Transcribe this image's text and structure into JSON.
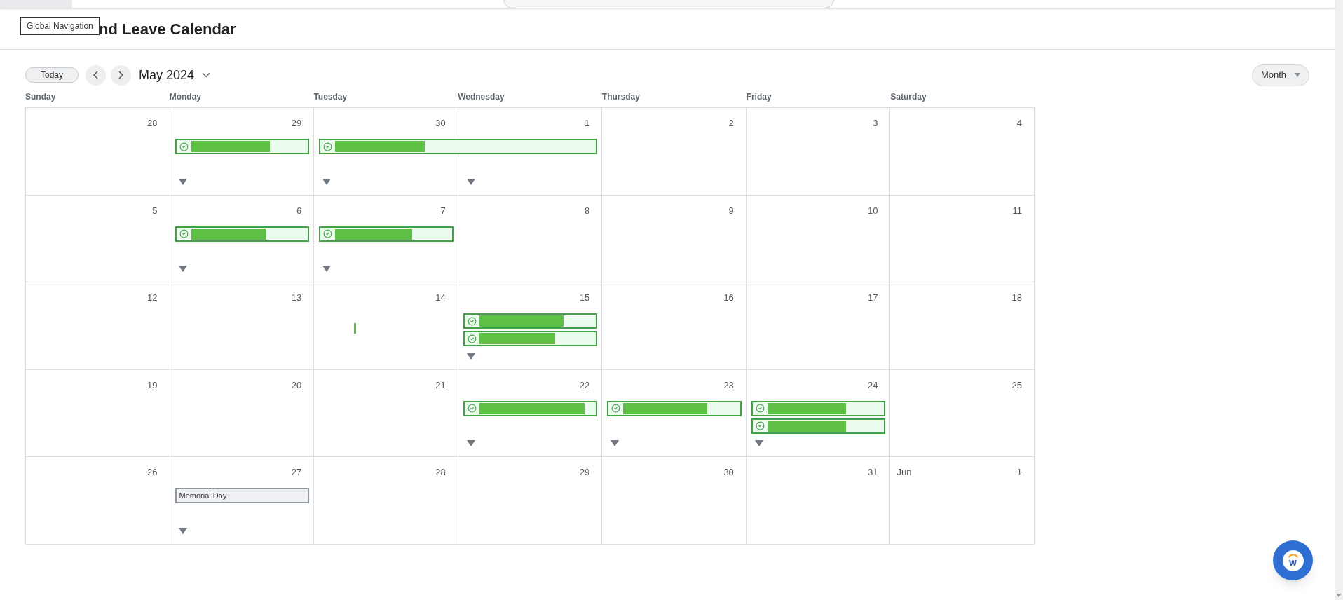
{
  "header": {
    "title": "nd Leave Calendar",
    "tooltip": "Global Navigation"
  },
  "toolbar": {
    "today": "Today",
    "period": "May 2024",
    "view": "Month"
  },
  "weekdays": [
    "Sunday",
    "Monday",
    "Tuesday",
    "Wednesday",
    "Thursday",
    "Friday",
    "Saturday"
  ],
  "weeks": [
    {
      "days": [
        {
          "day": "28",
          "more": false
        },
        {
          "day": "29",
          "more": true,
          "events": [
            {
              "kind": "leave",
              "continues": false
            }
          ]
        },
        {
          "day": "30",
          "more": true,
          "events": [
            {
              "kind": "leave",
              "continues": true
            }
          ]
        },
        {
          "day": "1",
          "more": true
        },
        {
          "day": "2",
          "more": false
        },
        {
          "day": "3",
          "more": false
        },
        {
          "day": "4",
          "more": false
        }
      ]
    },
    {
      "days": [
        {
          "day": "5",
          "more": false
        },
        {
          "day": "6",
          "more": true,
          "events": [
            {
              "kind": "leave",
              "continues": false
            }
          ]
        },
        {
          "day": "7",
          "more": true,
          "events": [
            {
              "kind": "leave",
              "continues": false
            }
          ]
        },
        {
          "day": "8",
          "more": false
        },
        {
          "day": "9",
          "more": false
        },
        {
          "day": "10",
          "more": false
        },
        {
          "day": "11",
          "more": false
        }
      ]
    },
    {
      "days": [
        {
          "day": "12",
          "more": false
        },
        {
          "day": "13",
          "more": false
        },
        {
          "day": "14",
          "more": false,
          "events": [
            {
              "kind": "mark"
            }
          ]
        },
        {
          "day": "15",
          "more": true,
          "events": [
            {
              "kind": "leave",
              "continues": false
            },
            {
              "kind": "leave",
              "continues": false
            }
          ]
        },
        {
          "day": "16",
          "more": false
        },
        {
          "day": "17",
          "more": false
        },
        {
          "day": "18",
          "more": false
        }
      ]
    },
    {
      "days": [
        {
          "day": "19",
          "more": false
        },
        {
          "day": "20",
          "more": false
        },
        {
          "day": "21",
          "more": false
        },
        {
          "day": "22",
          "more": true,
          "events": [
            {
              "kind": "leave",
              "continues": false
            }
          ]
        },
        {
          "day": "23",
          "more": true,
          "events": [
            {
              "kind": "leave",
              "continues": false
            }
          ]
        },
        {
          "day": "24",
          "more": true,
          "events": [
            {
              "kind": "leave",
              "continues": false
            },
            {
              "kind": "leave",
              "continues": false
            }
          ]
        },
        {
          "day": "25",
          "more": false
        }
      ]
    },
    {
      "days": [
        {
          "day": "26",
          "more": false
        },
        {
          "day": "27",
          "more": true,
          "events": [
            {
              "kind": "holiday",
              "label": "Memorial Day"
            }
          ]
        },
        {
          "day": "28",
          "more": false
        },
        {
          "day": "29",
          "more": false
        },
        {
          "day": "30",
          "more": false
        },
        {
          "day": "31",
          "more": false
        },
        {
          "day": "1",
          "month": "Jun",
          "more": false
        }
      ]
    }
  ],
  "chat_button": {
    "logo_text": "w"
  }
}
